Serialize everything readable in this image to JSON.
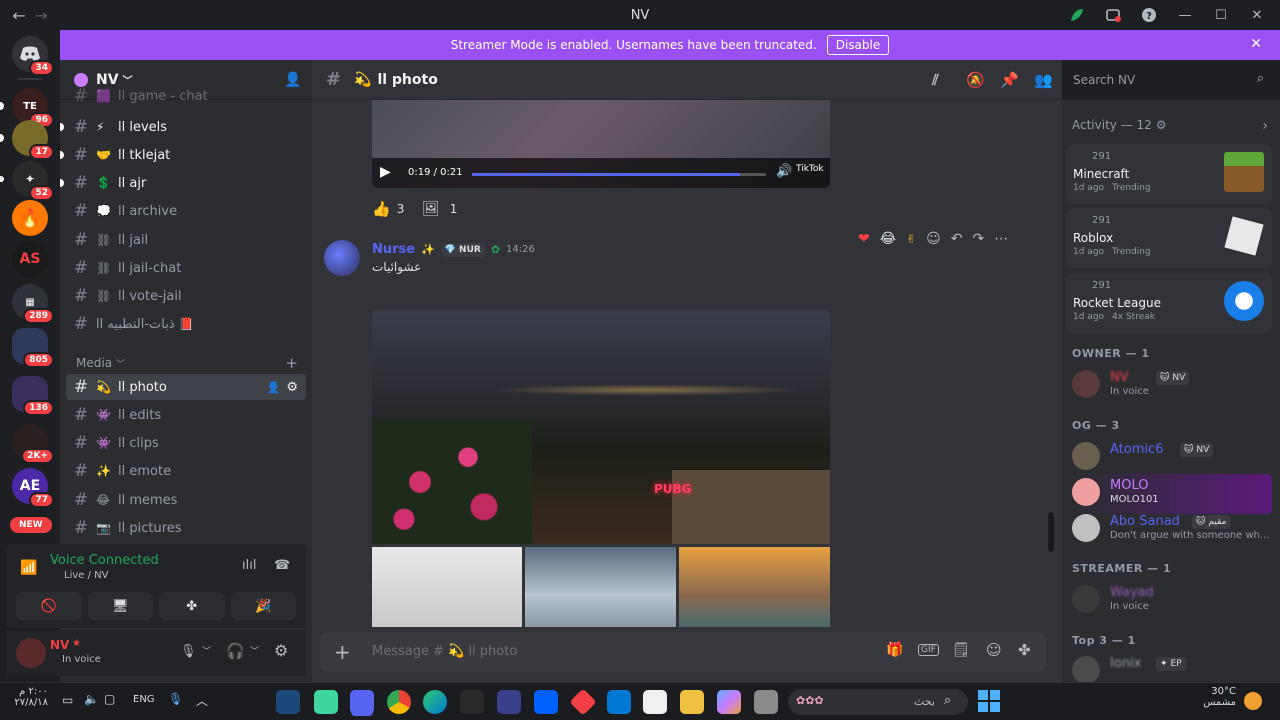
{
  "window": {
    "title": "NV",
    "back": "←",
    "forward": "→"
  },
  "banner": {
    "text": "Streamer Mode is enabled. Usernames have been truncated.",
    "button": "Disable"
  },
  "guild_badges": [
    "34",
    "96",
    "17",
    "52",
    "289",
    "805",
    "136",
    "2K+",
    "77"
  ],
  "guild_new": "NEW",
  "server": {
    "name": "NV"
  },
  "channels": [
    {
      "name": "ll game - chat",
      "emoji": "🟪"
    },
    {
      "name": "ll levels",
      "emoji": "⚡"
    },
    {
      "name": "ll tklejat",
      "emoji": "🤝"
    },
    {
      "name": "ll ajr",
      "emoji": "💲"
    },
    {
      "name": "ll archive",
      "emoji": "💭"
    },
    {
      "name": "ll jail",
      "emoji": "⛓"
    },
    {
      "name": "ll jail-chat",
      "emoji": "⛓"
    },
    {
      "name": "ll vote-jail",
      "emoji": "⛓"
    },
    {
      "name": "ll ذبات-التطبيه",
      "emoji": "📕"
    }
  ],
  "category": {
    "name": "Media",
    "add": "+"
  },
  "media_channels": [
    {
      "name": "ll photo",
      "emoji": "💫"
    },
    {
      "name": "ll edits",
      "emoji": "👾"
    },
    {
      "name": "ll clips",
      "emoji": "👾"
    },
    {
      "name": "ll emote",
      "emoji": "✨"
    },
    {
      "name": "ll memes",
      "emoji": "😂"
    },
    {
      "name": "ll pictures",
      "emoji": "📷"
    }
  ],
  "voice": {
    "status": "Voice Connected",
    "location": "Live / NV"
  },
  "user": {
    "name": "NV",
    "status": "In voice"
  },
  "channel_header": {
    "name": "ll photo",
    "emoji": "💫"
  },
  "search": {
    "placeholder": "Search NV"
  },
  "video": {
    "time": "0:19 / 0:21",
    "watermark": "TikTok"
  },
  "reactions": [
    {
      "emoji": "👍",
      "count": "3"
    },
    {
      "emoji": "🖼",
      "count": "1"
    }
  ],
  "message": {
    "author": "Nurse",
    "tag": "NUR",
    "time": "14:26",
    "text": "عشوائيات",
    "photo_sign": "PUBG"
  },
  "composer": {
    "placeholder": "Message # 💫 ll photo",
    "add": "+"
  },
  "activity": {
    "header": "Activity — 12",
    "items": [
      {
        "count": "291",
        "name": "Minecraft",
        "time": "1d ago",
        "tag": "Trending"
      },
      {
        "count": "291",
        "name": "Roblox",
        "time": "1d ago",
        "tag": "Trending"
      },
      {
        "count": "291",
        "name": "Rocket League",
        "time": "1d ago",
        "tag": "4x Streak"
      }
    ]
  },
  "roles": [
    {
      "label": "OWNER — 1"
    },
    {
      "label": "OG — 3"
    },
    {
      "label": "STREAMER — 1"
    },
    {
      "label": "Top 3 — 1"
    }
  ],
  "members": [
    {
      "name": "NV",
      "tag": "NV",
      "sub": "In voice",
      "color": "#f23f43"
    },
    {
      "name": "Atomic6",
      "tag": "NV",
      "sub": "",
      "color": "#5865f2"
    },
    {
      "name": "MOLO",
      "tag": "",
      "sub": "MOLO101",
      "color": "#c77dff"
    },
    {
      "name": "Abo Sanad",
      "tag": "مقيم",
      "sub": "Don't argue with someone wh...",
      "color": "#5865f2"
    },
    {
      "name": "Wayad",
      "tag": "",
      "sub": "In voice",
      "color": "#9b59b6"
    },
    {
      "name": "Ionix",
      "tag": "EP",
      "sub": "",
      "color": "#949ba4"
    }
  ],
  "taskbar": {
    "time": "٢:٠٠ م",
    "date": "٢٧/٨/١٨",
    "lang": "ENG",
    "search": "بحث",
    "weather_temp": "30°C",
    "weather_desc": "مشمس"
  }
}
